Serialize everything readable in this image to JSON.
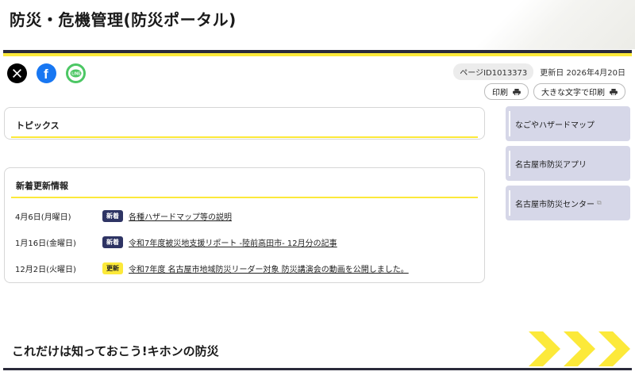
{
  "header": {
    "title": "防災・危機管理(防災ポータル)"
  },
  "social": {
    "x_label": "X",
    "facebook_label": "Facebook",
    "line_label": "LINE"
  },
  "meta": {
    "page_id": "ページID1013373",
    "updated": "更新日 2026年4月20日"
  },
  "print": {
    "print_label": "印刷",
    "large_print_label": "大きな文字で印刷"
  },
  "topics": {
    "heading": "トピックス"
  },
  "news": {
    "heading": "新着更新情報",
    "items": [
      {
        "date": "4月6日(月曜日)",
        "tag": "新着",
        "text": "各種ハザードマップ等の説明"
      },
      {
        "date": "1月16日(金曜日)",
        "tag": "新着",
        "text": "令和7年度被災地支援リポート -陸前高田市- 12月分の記事"
      },
      {
        "date": "12月2日(火曜日)",
        "tag": "更新",
        "text": "令和7年度 名古屋市地域防災リーダー対象 防災講演会の動画を公開しました。"
      }
    ]
  },
  "sidebar": {
    "items": [
      {
        "label": "なごやハザードマップ"
      },
      {
        "label": "名古屋市防災アプリ"
      },
      {
        "label": "名古屋市防災センター"
      }
    ]
  },
  "section": {
    "title": "これだけは知っておこう!キホンの防災"
  },
  "colors": {
    "accent_yellow": "#fce93a",
    "navy": "#2e3464",
    "sidebar_bg": "#d6d7e8"
  }
}
